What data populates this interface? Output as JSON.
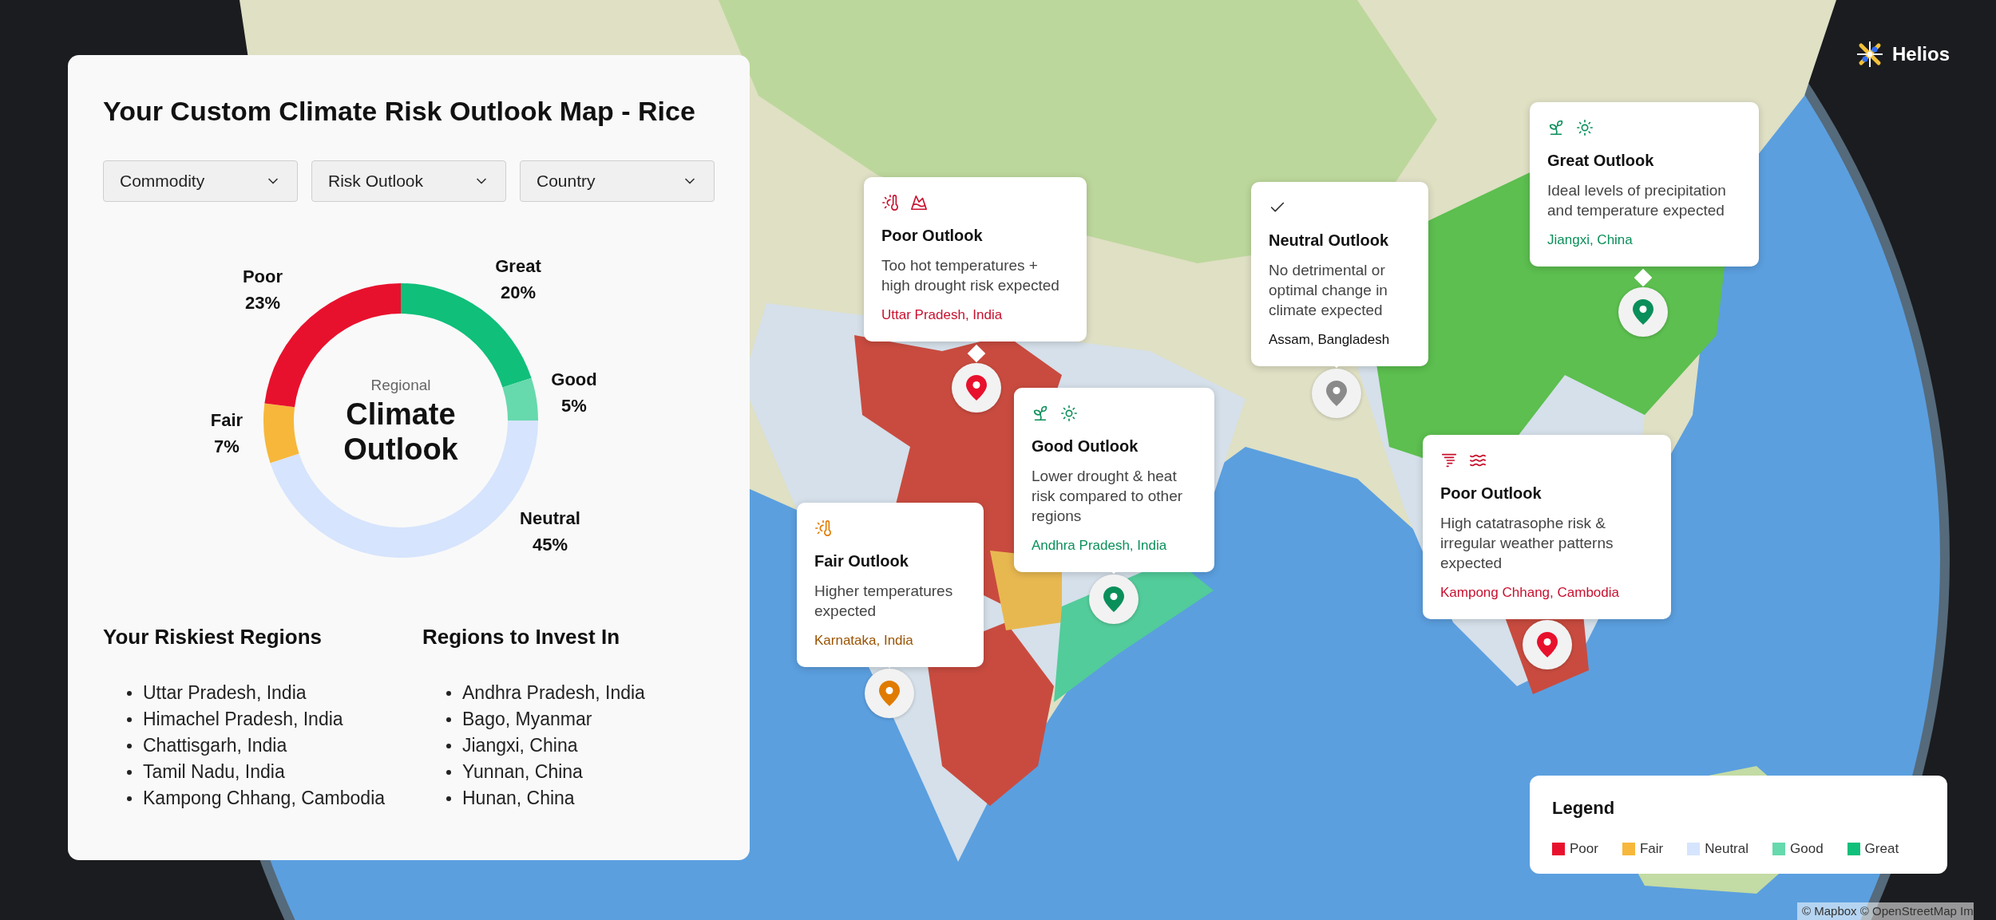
{
  "brand": {
    "name": "Helios"
  },
  "panel": {
    "title": "Your Custom Climate Risk Outlook Map - Rice",
    "filters": [
      {
        "label": "Commodity"
      },
      {
        "label": "Risk Outlook"
      },
      {
        "label": "Country"
      }
    ],
    "chart": {
      "subtitle": "Regional",
      "title": "Climate Outlook",
      "chart_data": {
        "type": "donut",
        "categories": [
          "Great",
          "Good",
          "Neutral",
          "Fair",
          "Poor"
        ],
        "values": [
          20,
          5,
          45,
          7,
          23
        ],
        "value_labels": [
          "20%",
          "5%",
          "45%",
          "7%",
          "23%"
        ],
        "colors": [
          "#0fbf7a",
          "#66d9ad",
          "#d6e4fd",
          "#f7b73a",
          "#e8112d"
        ]
      }
    },
    "riskiest": {
      "heading": "Your Riskiest Regions",
      "items": [
        "Uttar Pradesh, India",
        "Himachel Pradesh, India",
        "Chattisgarh, India",
        "Tamil Nadu, India",
        "Kampong Chhang, Cambodia"
      ]
    },
    "invest": {
      "heading": "Regions to Invest In",
      "items": [
        "Andhra Pradesh, India",
        "Bago, Myanmar",
        "Jiangxi, China",
        "Yunnan, China",
        "Hunan, China"
      ]
    }
  },
  "popups": [
    {
      "kind": "great",
      "title": "Great Outlook",
      "text": "Ideal levels of precipitation and temperature expected",
      "location": "Jiangxi, China"
    },
    {
      "kind": "poor",
      "title": "Poor Outlook",
      "text": "Too hot temperatures + high drought risk expected",
      "location": "Uttar Pradesh, India"
    },
    {
      "kind": "neutral",
      "title": "Neutral Outlook",
      "text": "No detrimental or optimal change in climate expected",
      "location": "Assam, Bangladesh"
    },
    {
      "kind": "good",
      "title": "Good Outlook",
      "text": "Lower drought & heat risk compared to other regions",
      "location": "Andhra Pradesh, India"
    },
    {
      "kind": "poor",
      "title": "Poor Outlook",
      "text": "High catatrasophe risk & irregular weather patterns expected",
      "location": "Kampong Chhang, Cambodia"
    },
    {
      "kind": "fair",
      "title": "Fair Outlook",
      "text": "Higher temperatures expected",
      "location": "Karnataka, India"
    }
  ],
  "legend": {
    "title": "Legend",
    "items": [
      {
        "label": "Poor",
        "color": "#e8112d"
      },
      {
        "label": "Fair",
        "color": "#f7b73a"
      },
      {
        "label": "Neutral",
        "color": "#d6e4fd"
      },
      {
        "label": "Good",
        "color": "#66d9ad"
      },
      {
        "label": "Great",
        "color": "#0fbf7a"
      }
    ]
  },
  "attribution": "© Mapbox © OpenStreetMap Im"
}
